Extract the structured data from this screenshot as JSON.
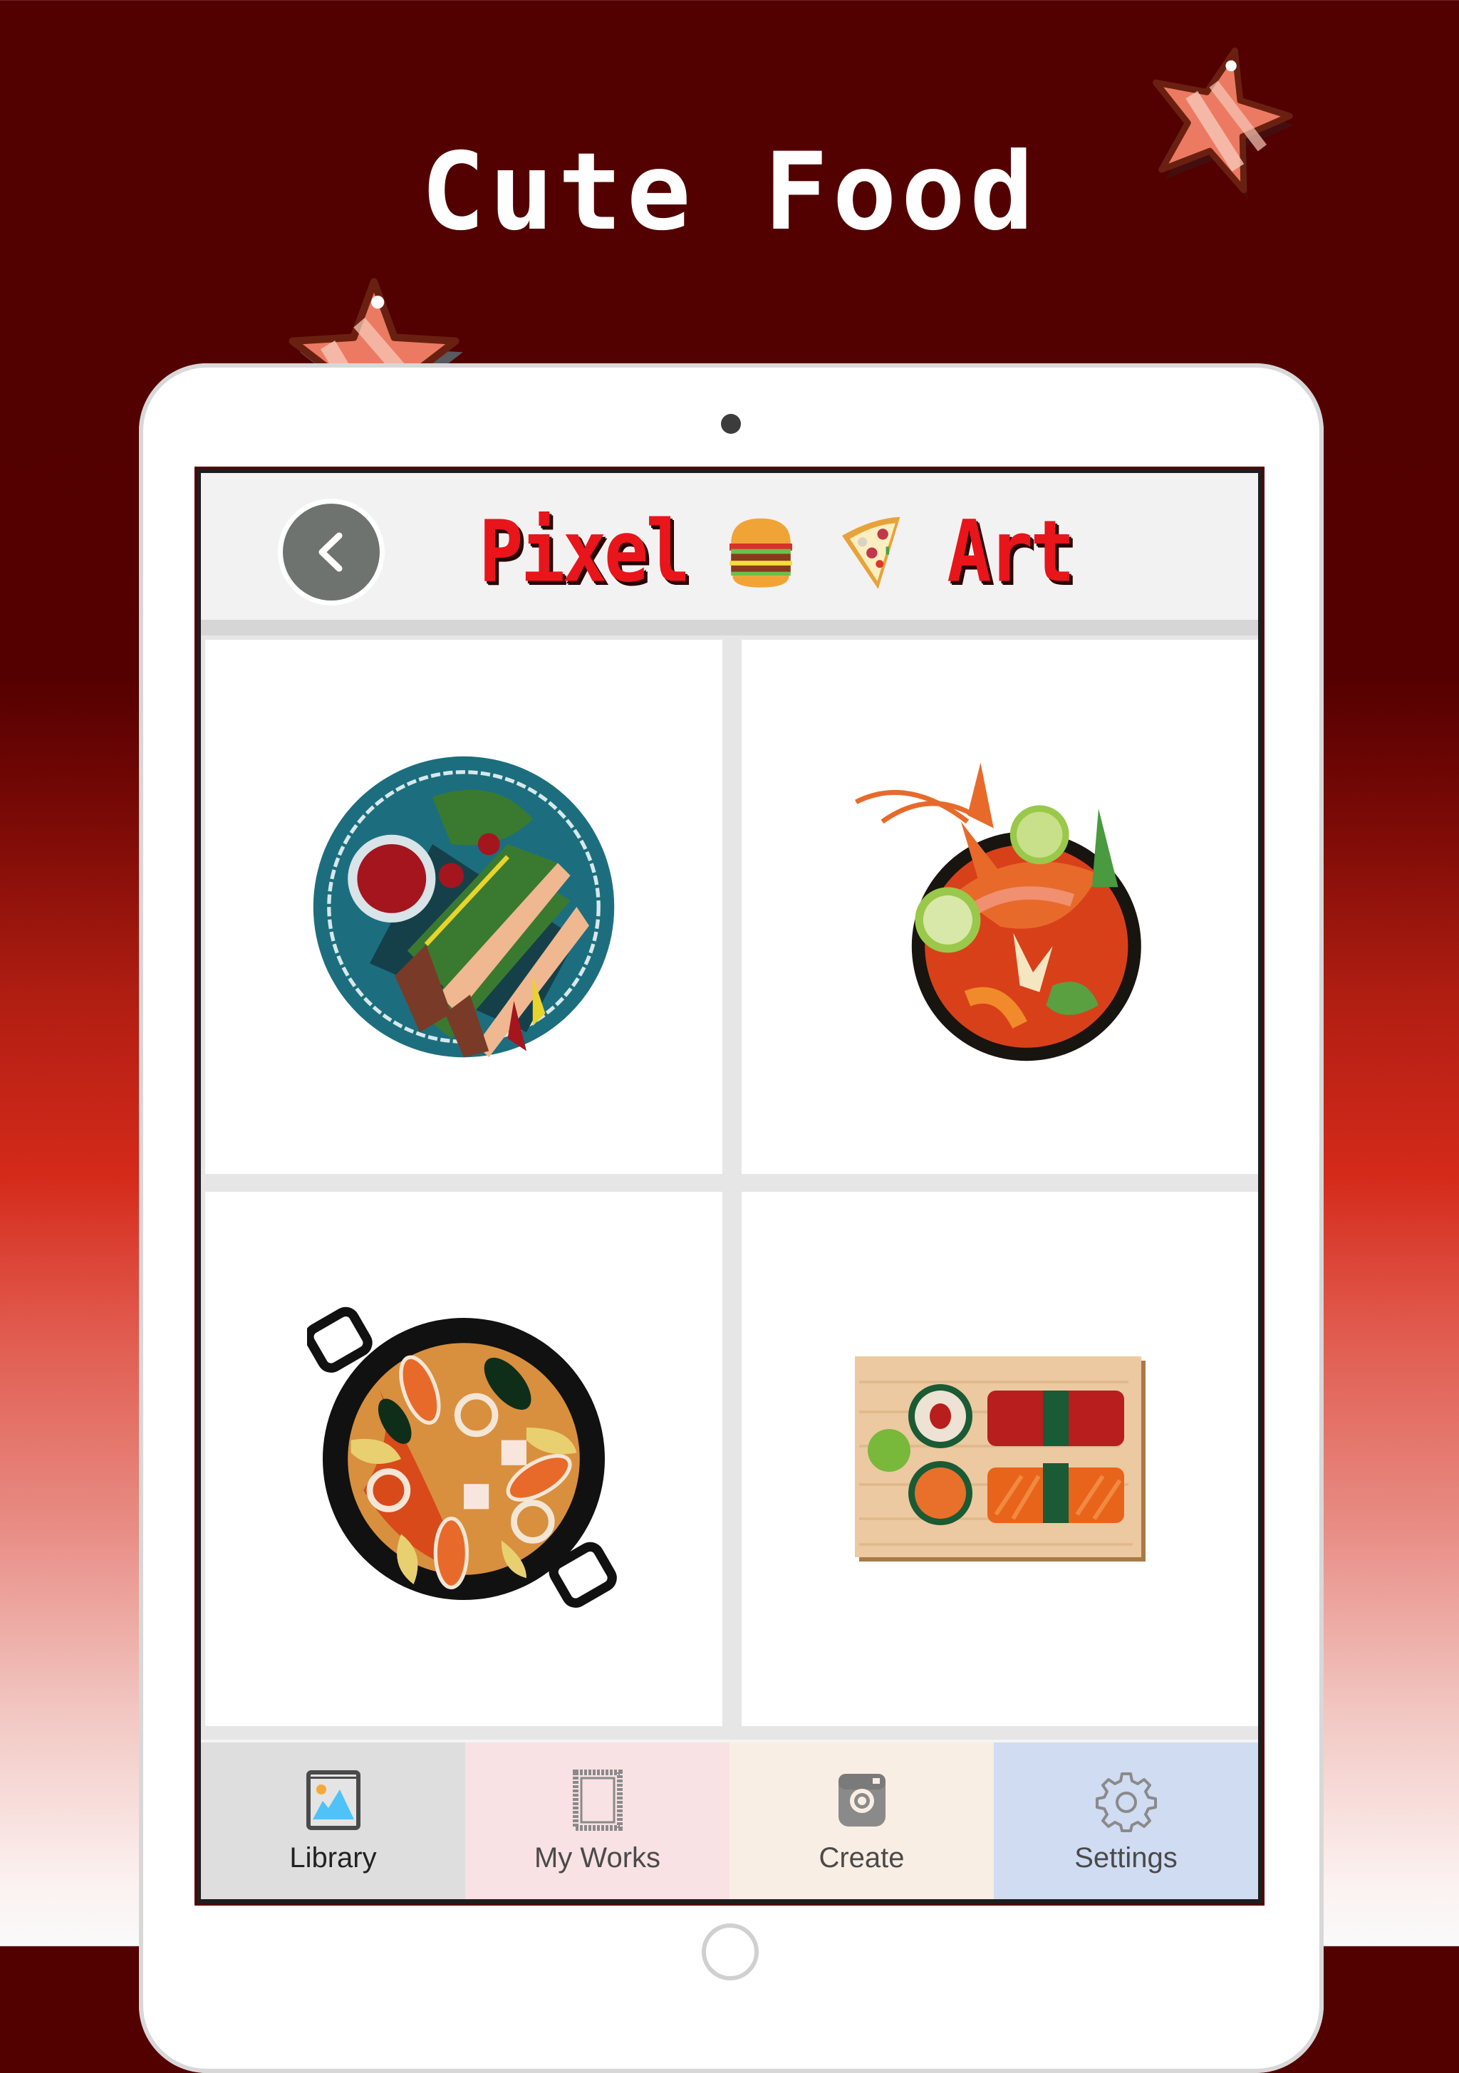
{
  "promo": {
    "title": "Cute Food"
  },
  "header": {
    "title_left": "Pixel",
    "title_right": "Art",
    "title_icons": [
      "hamburger-icon",
      "pizza-slice-icon"
    ],
    "back_icon": "chevron-left-icon"
  },
  "gallery": {
    "items": [
      {
        "name": "Tacos plate",
        "icon": "tacos-artwork"
      },
      {
        "name": "Shrimp soup",
        "icon": "shrimp-soup-artwork"
      },
      {
        "name": "Seafood paella",
        "icon": "paella-artwork"
      },
      {
        "name": "Sushi board",
        "icon": "sushi-artwork"
      }
    ]
  },
  "tabs": [
    {
      "label": "Library",
      "icon": "image-gallery-icon",
      "active": true,
      "bg": "#dedede"
    },
    {
      "label": "My Works",
      "icon": "picture-frame-icon",
      "active": false,
      "bg": "#f9e2e3"
    },
    {
      "label": "Create",
      "icon": "camera-icon",
      "active": false,
      "bg": "#f9eee4"
    },
    {
      "label": "Settings",
      "icon": "gear-icon",
      "active": false,
      "bg": "#d0dcf2"
    }
  ],
  "colors": {
    "accent_red": "#e8151b",
    "background_top": "#520000",
    "background_mid": "#d42a1a"
  }
}
